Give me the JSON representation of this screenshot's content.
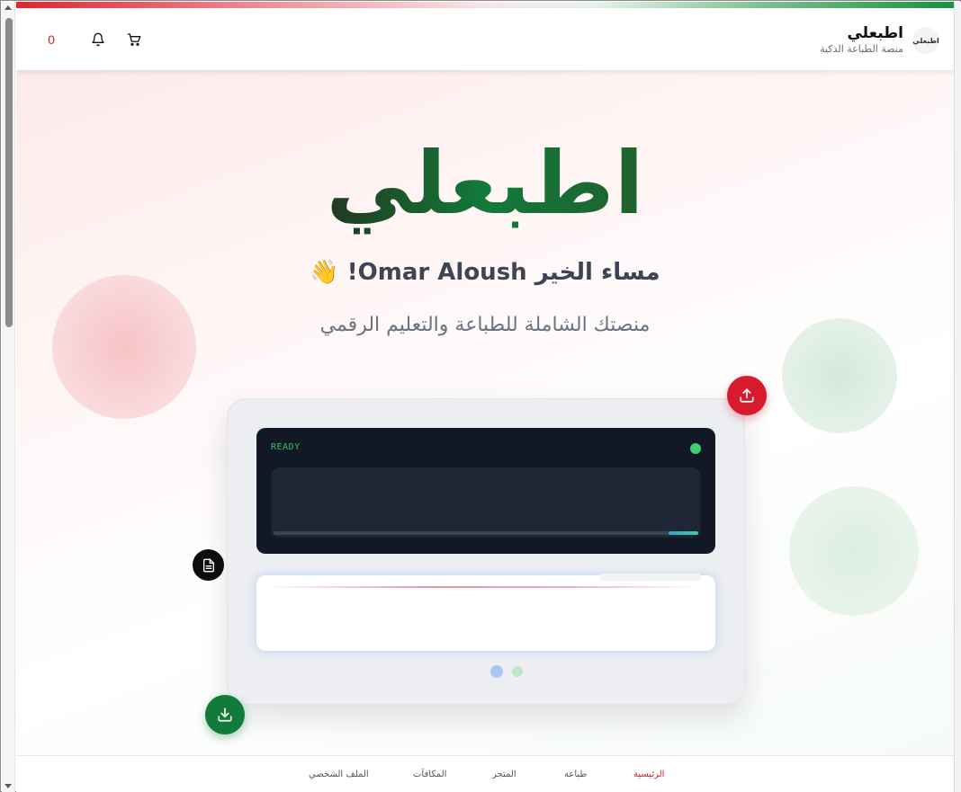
{
  "header": {
    "brand_name": "اطبعلي",
    "brand_tagline": "منصة الطباعة الذكية",
    "logo_text": "اطبعلي",
    "points": "0",
    "icons": [
      "cart-icon",
      "bell-icon"
    ]
  },
  "hero": {
    "title": "اطبعلي",
    "greeting": "مساء الخير Omar Aloush! 👋",
    "subtitle": "منصتك الشاملة للطباعة والتعليم الرقمي"
  },
  "device": {
    "screen_status": "READY",
    "progress": 0.07,
    "actions": [
      "upload-icon",
      "document-icon",
      "download-icon"
    ]
  },
  "nav": {
    "items": [
      {
        "label": "الرئيسية",
        "active": true
      },
      {
        "label": "طباعة",
        "active": false
      },
      {
        "label": "المتجر",
        "active": false
      },
      {
        "label": "المكافآت",
        "active": false
      },
      {
        "label": "الملف الشخصي",
        "active": false
      }
    ]
  },
  "colors": {
    "brand_red": "#d81b2c",
    "brand_green": "#127a3a",
    "screen_bg": "#121826",
    "ready_green": "#35c46a"
  }
}
